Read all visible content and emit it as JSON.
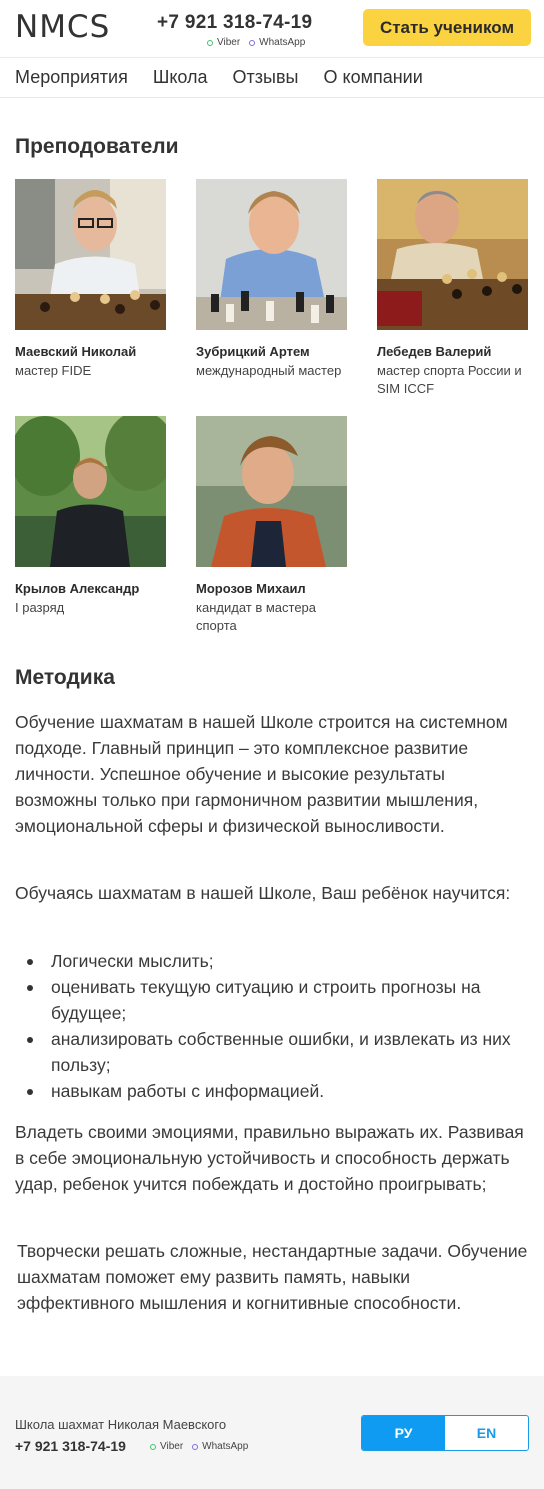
{
  "header": {
    "logo": "NMCS",
    "phone": "+7 921 318-74-19",
    "viber": "Viber",
    "whatsapp": "WhatsApp",
    "cta": "Стать учеником"
  },
  "nav": [
    "Мероприятия",
    "Школа",
    "Отзывы",
    "О компании"
  ],
  "teachers_heading": "Преподователи",
  "teachers": [
    {
      "name": "Маевский Николай",
      "title": "мастер FIDE"
    },
    {
      "name": "Зубрицкий Артем",
      "title": "международный мастер"
    },
    {
      "name": "Лебедев Валерий",
      "title": "мастер спорта России и SIM ICCF"
    },
    {
      "name": "Крылов Александр",
      "title": "I разряд"
    },
    {
      "name": "Морозов Михаил",
      "title": "кандидат в мастера спорта"
    }
  ],
  "method_heading": "Методика",
  "method_p1": "Обучение шахматам в нашей Школе строится на системном подходе. Главный принцип – это комплексное развитие личности. Успешное обучение и высокие результаты возможны только при гармоничном развитии мышления, эмоциональной сферы и физической выносливости.",
  "method_p2": "Обучаясь шахматам в нашей Школе, Ваш ребёнок научится:",
  "method_list": [
    "Логически мыслить;",
    "оценивать текущую ситуацию и строить прогнозы на будущее;",
    "анализировать собственные ошибки, и извлекать из них пользу;",
    "навыкам работы с информацией."
  ],
  "method_p3": "Владеть своими эмоциями, правильно выражать их. Развивая в себе эмоциональную устойчивость и способность держать удар, ребенок учится побеждать и достойно проигрывать;",
  "method_p4": "Творчески решать сложные, нестандартные задачи. Обучение шахматам поможет ему развить память,  навыки эффективного мышления и когнитивные способности.",
  "footer": {
    "school": "Школа шахмат Николая Маевского",
    "phone": "+7 921 318-74-19",
    "viber": "Viber",
    "whatsapp": "WhatsApp",
    "lang_ru": "РУ",
    "lang_en": "EN"
  }
}
